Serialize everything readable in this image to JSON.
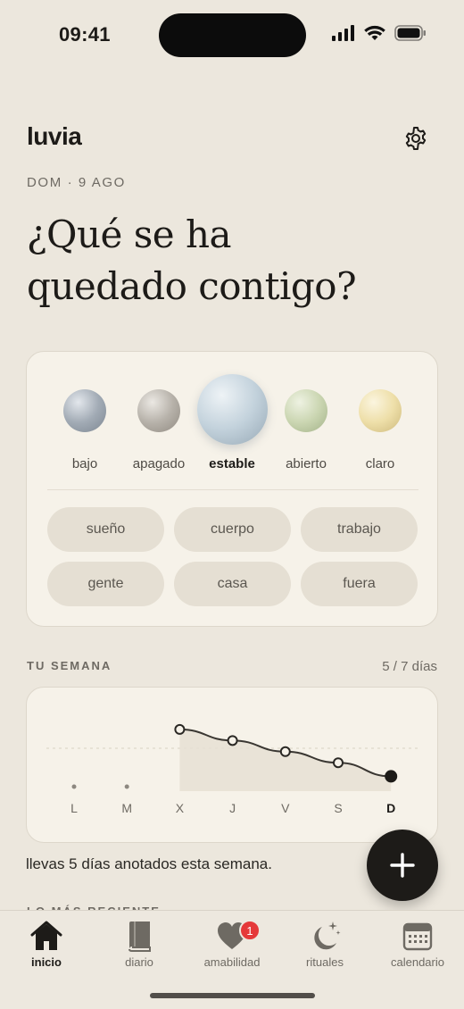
{
  "status": {
    "time": "09:41"
  },
  "app": {
    "title": "luvia"
  },
  "header": {
    "date": "DOM · 9 AGO",
    "question_line1": "¿Qué se ha",
    "question_line2": "quedado contigo?"
  },
  "moods": [
    {
      "label": "bajo",
      "color": "#9aa3ad",
      "selected": false
    },
    {
      "label": "apagado",
      "color": "#b3aea6",
      "selected": false
    },
    {
      "label": "estable",
      "color": "#bccbd5",
      "selected": true
    },
    {
      "label": "abierto",
      "color": "#c7d3ad",
      "selected": false
    },
    {
      "label": "claro",
      "color": "#ecdca7",
      "selected": false
    }
  ],
  "tags": [
    "sueño",
    "cuerpo",
    "trabajo",
    "gente",
    "casa",
    "fuera"
  ],
  "week": {
    "title": "TU SEMANA",
    "count": "5 / 7 días",
    "summary": "llevas 5 días anotados esta semana."
  },
  "chart_data": {
    "type": "line",
    "categories": [
      "L",
      "M",
      "X",
      "J",
      "V",
      "S",
      "D"
    ],
    "values": [
      null,
      null,
      5,
      4.1,
      3.2,
      2.3,
      1.2
    ],
    "current": "D",
    "ylim": [
      0,
      5.5
    ]
  },
  "recent": {
    "title": "LO MÁS RECIENTE"
  },
  "tabs": [
    {
      "label": "inicio",
      "active": true
    },
    {
      "label": "diario",
      "active": false
    },
    {
      "label": "amabilidad",
      "active": false,
      "badge": "1"
    },
    {
      "label": "rituales",
      "active": false
    },
    {
      "label": "calendario",
      "active": false
    }
  ],
  "colors": {
    "background": "#ece7dd",
    "card": "#f6f2e9",
    "accent": "#1d1b18",
    "badge": "#e5393a"
  }
}
